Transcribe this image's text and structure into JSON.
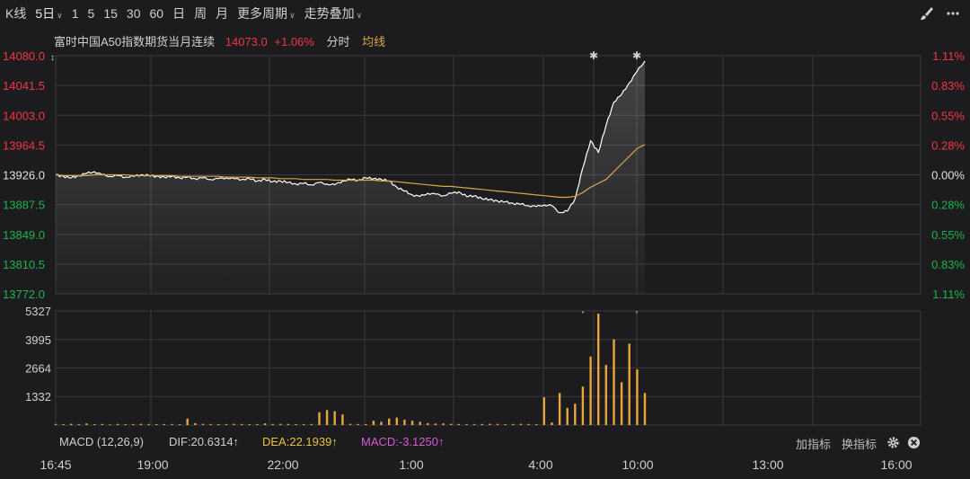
{
  "toolbar": {
    "items": [
      "K线",
      "5日",
      "1",
      "5",
      "15",
      "30",
      "60",
      "日",
      "周",
      "月",
      "更多周期",
      "走势叠加"
    ]
  },
  "legend": {
    "name": "富时中国A50指数期货当月连续",
    "price": "14073.0",
    "change": "+1.06%",
    "mode": "分时",
    "ma_label": "均线"
  },
  "price_axis": {
    "left_labels": [
      "14080.0",
      "14041.5",
      "14003.0",
      "13964.5",
      "13926.0",
      "13887.5",
      "13849.0",
      "13810.5",
      "13772.0"
    ],
    "right_labels": [
      "1.11%",
      "0.83%",
      "0.55%",
      "0.28%",
      "0.00%",
      "0.28%",
      "0.55%",
      "0.83%",
      "1.11%"
    ]
  },
  "volume_axis": {
    "labels": [
      "5327",
      "3995",
      "2664",
      "1332"
    ]
  },
  "indicator": {
    "macd_label": "MACD (12,26,9)",
    "dif": "DIF:20.6314↑",
    "dea": "DEA:22.1939↑",
    "macd": "MACD:-3.1250↑",
    "add_label": "加指标",
    "swap_label": "换指标"
  },
  "time_axis": [
    "16:45",
    "19:00",
    "22:00",
    "1:00",
    "4:00",
    "10:00",
    "13:00",
    "16:00"
  ],
  "colors": {
    "background": "#1c1c1e",
    "up": "#f23645",
    "down": "#1fb24b",
    "price_line": "#ffffff",
    "avg_line": "#d9a74a",
    "volume": "#e8a53a",
    "grid": "#3a3a3c"
  },
  "chart_data": {
    "type": "line",
    "y_range": [
      13772.0,
      14080.0
    ],
    "prev_close": 13926.0,
    "series": [
      {
        "name": "",
        "values": [
          13926,
          13924,
          13922,
          13925,
          13928,
          13930,
          13926,
          13924,
          13925,
          13923,
          13924,
          13926,
          13925,
          13924,
          13923,
          13924,
          13922,
          13923,
          13921,
          13922,
          13920,
          13921,
          13922,
          13921,
          13920,
          13921,
          13918,
          13920,
          13917,
          13918,
          13916,
          13914,
          13915,
          13913,
          13916,
          13914,
          13913,
          13918,
          13920,
          13919,
          13922,
          13921,
          13920,
          13918,
          13910,
          13905,
          13900,
          13898,
          13902,
          13901,
          13899,
          13902,
          13904,
          13898,
          13899,
          13895,
          13894,
          13892,
          13891,
          13889,
          13888,
          13886,
          13885,
          13887,
          13886,
          13877,
          13879,
          13895,
          13935,
          13970,
          13955,
          13990,
          14020,
          14030,
          14045,
          14060,
          14073
        ]
      },
      {
        "name": "均线",
        "values": [
          13926,
          13925,
          13925,
          13925,
          13925,
          13926,
          13926,
          13926,
          13926,
          13926,
          13925,
          13925,
          13925,
          13925,
          13925,
          13925,
          13924,
          13924,
          13924,
          13924,
          13924,
          13924,
          13923,
          13923,
          13923,
          13923,
          13922,
          13922,
          13922,
          13921,
          13921,
          13921,
          13920,
          13920,
          13920,
          13920,
          13919,
          13919,
          13919,
          13919,
          13919,
          13919,
          13918,
          13918,
          13917,
          13916,
          13915,
          13914,
          13913,
          13912,
          13911,
          13911,
          13910,
          13909,
          13908,
          13907,
          13906,
          13905,
          13904,
          13903,
          13902,
          13901,
          13900,
          13899,
          13898,
          13897,
          13897,
          13898,
          13903,
          13910,
          13915,
          13920,
          13930,
          13940,
          13950,
          13960,
          13965
        ]
      }
    ],
    "volume": {
      "y_range": [
        0,
        5327
      ],
      "values": [
        50,
        40,
        60,
        45,
        80,
        40,
        50,
        35,
        55,
        40,
        45,
        60,
        50,
        40,
        45,
        50,
        40,
        300,
        90,
        60,
        50,
        40,
        45,
        60,
        50,
        40,
        45,
        80,
        50,
        60,
        55,
        40,
        45,
        50,
        600,
        700,
        650,
        500,
        60,
        50,
        40,
        200,
        150,
        300,
        350,
        250,
        200,
        150,
        90,
        70,
        80,
        60,
        50,
        40,
        45,
        50,
        60,
        55,
        40,
        50,
        60,
        50,
        40,
        1300,
        120,
        1500,
        800,
        1000,
        1800,
        3200,
        5200,
        2800,
        4000,
        2000,
        3800,
        2600,
        1500
      ]
    },
    "time_ticks": [
      "16:45",
      "19:00",
      "22:00",
      "1:00",
      "4:00",
      "10:00",
      "13:00",
      "16:00"
    ]
  }
}
